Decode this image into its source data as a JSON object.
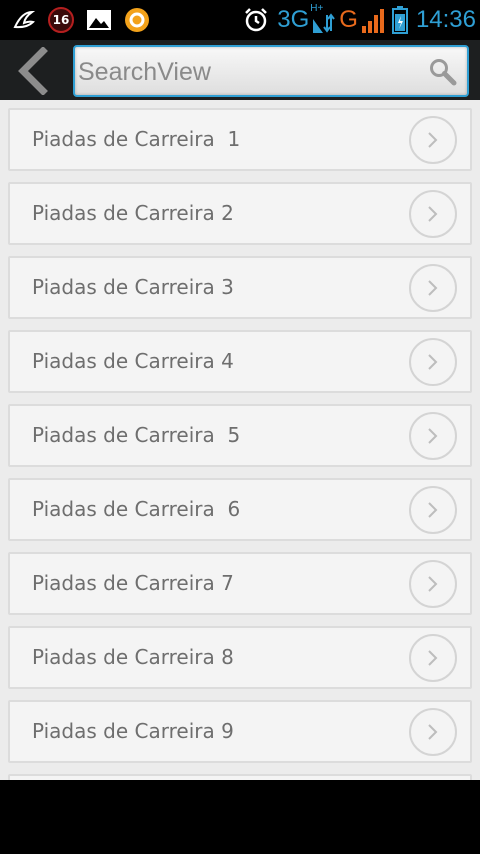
{
  "status_bar": {
    "notification_count": "16",
    "network_label": "3G",
    "network_type_small": "H+",
    "carrier_label": "G",
    "time": "14:36",
    "icons": [
      "app-notification-icon",
      "notification-count-badge",
      "image-icon",
      "sync-icon",
      "alarm-icon",
      "data-arrows-icon",
      "signal-icon",
      "battery-icon"
    ]
  },
  "action_bar": {
    "back_icon": "chevron-left-icon",
    "search": {
      "placeholder": "SearchView",
      "value": ""
    },
    "search_icon": "magnifier-icon",
    "colors": {
      "accent": "#2f9fd4",
      "bar_bg": "#1d1f20"
    }
  },
  "list": {
    "items": [
      {
        "label": "Piadas de Carreira  1"
      },
      {
        "label": "Piadas de Carreira 2"
      },
      {
        "label": "Piadas de Carreira 3"
      },
      {
        "label": "Piadas de Carreira 4"
      },
      {
        "label": "Piadas de Carreira  5"
      },
      {
        "label": "Piadas de Carreira  6"
      },
      {
        "label": "Piadas de Carreira 7"
      },
      {
        "label": "Piadas de Carreira 8"
      },
      {
        "label": "Piadas de Carreira 9"
      },
      {
        "label": ""
      }
    ],
    "item_icon": "chevron-right-icon"
  }
}
